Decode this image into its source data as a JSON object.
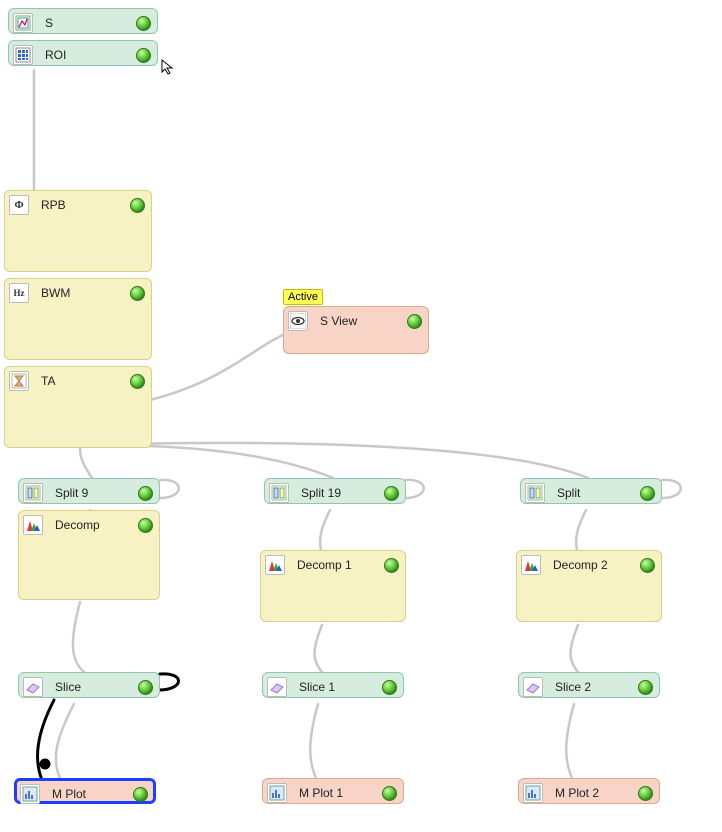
{
  "tooltip": {
    "active": "Active"
  },
  "nodes": {
    "s": {
      "label": "S"
    },
    "roi": {
      "label": "ROI"
    },
    "rpb": {
      "label": "RPB"
    },
    "bwm": {
      "label": "BWM"
    },
    "ta": {
      "label": "TA"
    },
    "sview": {
      "label": "S View"
    },
    "split9": {
      "label": "Split 9"
    },
    "decomp": {
      "label": "Decomp"
    },
    "slice": {
      "label": "Slice"
    },
    "mplot": {
      "label": "M Plot"
    },
    "split19": {
      "label": "Split 19"
    },
    "decomp1": {
      "label": "Decomp 1"
    },
    "slice1": {
      "label": "Slice 1"
    },
    "mplot1": {
      "label": "M Plot 1"
    },
    "split": {
      "label": "Split"
    },
    "decomp2": {
      "label": "Decomp 2"
    },
    "slice2": {
      "label": "Slice 2"
    },
    "mplot2": {
      "label": "M Plot 2"
    }
  },
  "icons": {
    "phi": "Φ",
    "hz": "Hz"
  }
}
